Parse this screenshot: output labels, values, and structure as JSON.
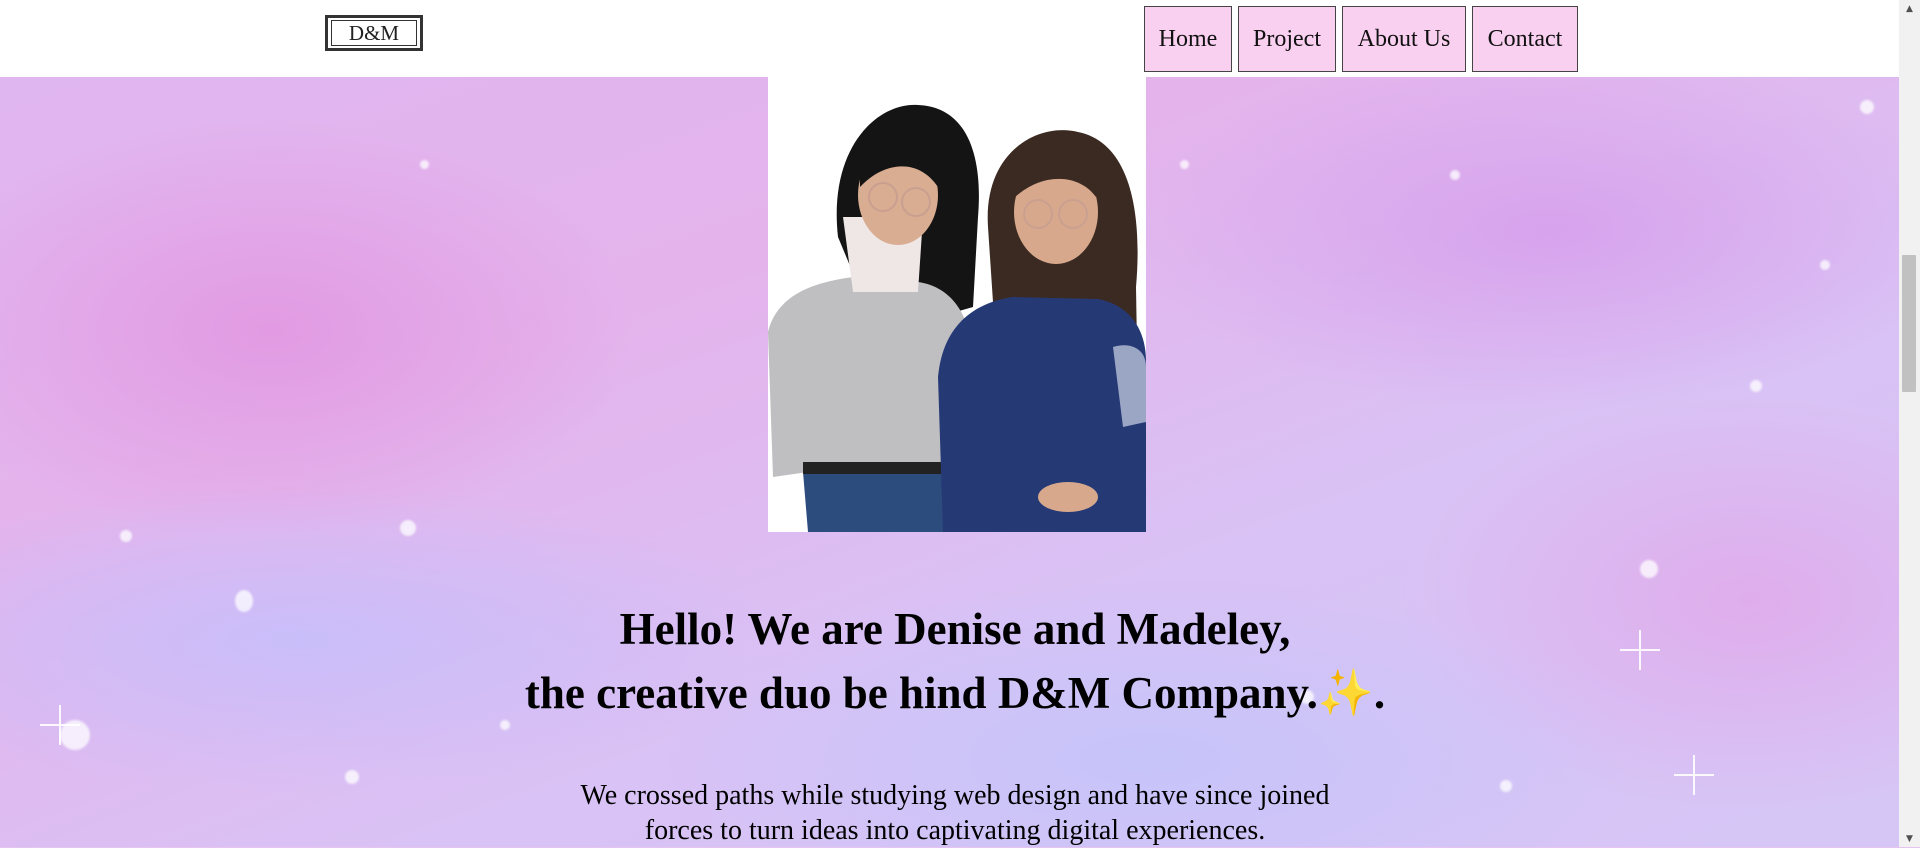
{
  "header": {
    "logo_text": "D&M",
    "nav": [
      {
        "label": "Home"
      },
      {
        "label": "Project"
      },
      {
        "label": "About Us"
      },
      {
        "label": "Contact"
      }
    ]
  },
  "hero": {
    "title_line1": "Hello! We are Denise and Madeley,",
    "title_line2": "the creative duo be hind D&M Company.",
    "title_emoji": "✨",
    "title_end": ".",
    "text_line1": "We crossed paths while studying web design and have since joined",
    "text_line2": "forces to turn ideas into captivating digital experiences."
  },
  "scrollbar": {
    "up_icon": "▲",
    "down_icon": "▼"
  },
  "colors": {
    "nav_bg": "#f9d0f0",
    "header_bg": "#ffffff",
    "page_bg": "#e6c4f2"
  }
}
